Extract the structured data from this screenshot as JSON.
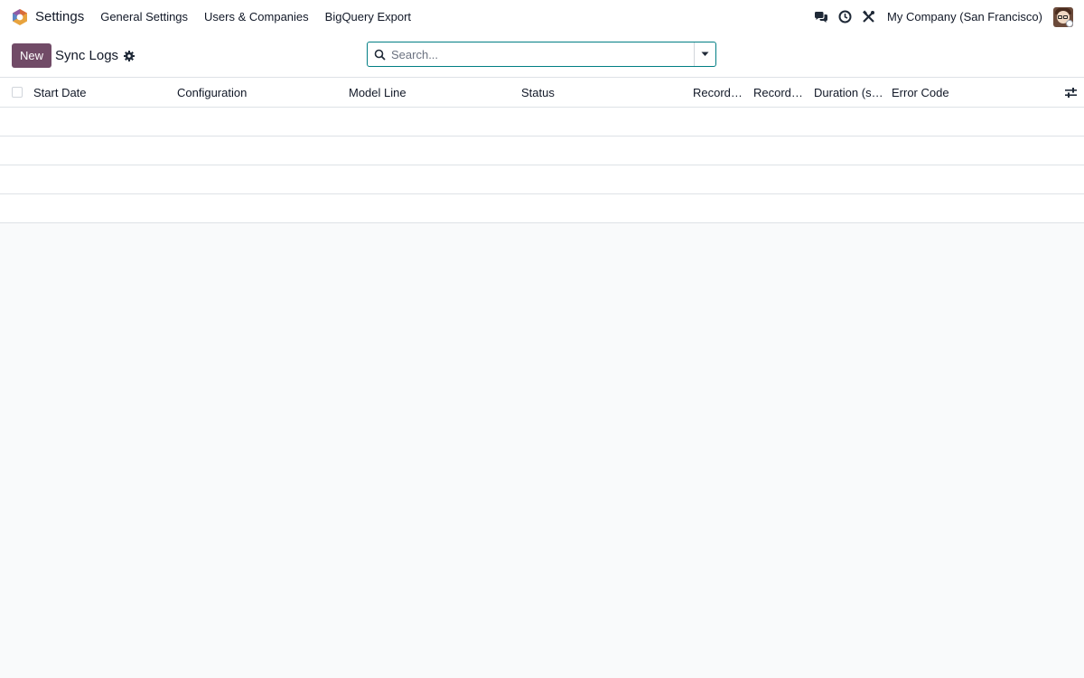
{
  "navbar": {
    "app_name": "Settings",
    "menu": [
      "General Settings",
      "Users & Companies",
      "BigQuery Export"
    ],
    "company": "My Company (San Francisco)"
  },
  "control_panel": {
    "new_label": "New",
    "title": "Sync Logs",
    "search_placeholder": "Search..."
  },
  "list": {
    "columns": [
      "Start Date",
      "Configuration",
      "Model Line",
      "Status",
      "Records ...",
      "Records ...",
      "Duration (se...",
      "Error Code"
    ],
    "empty_rows": 4
  },
  "colors": {
    "primary": "#714b67",
    "search_border": "#017e84",
    "background": "#f9fafb"
  }
}
